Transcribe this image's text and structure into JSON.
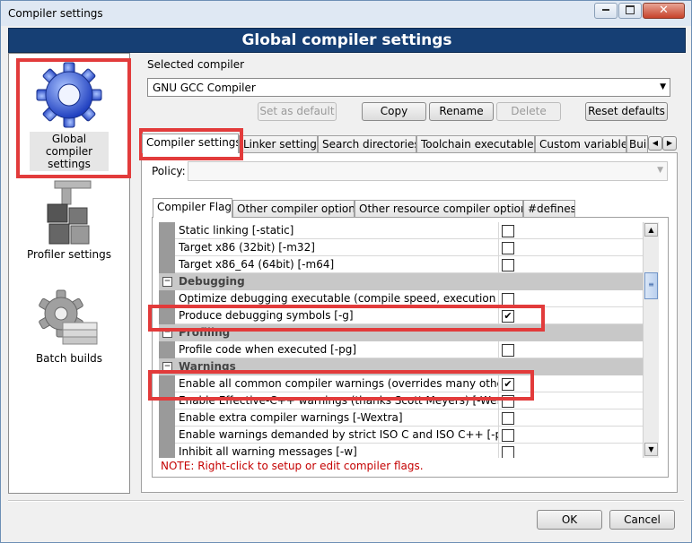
{
  "window": {
    "title": "Compiler settings",
    "minimize": "0",
    "maximize": "1",
    "close": "r"
  },
  "banner": {
    "title": "Global compiler settings"
  },
  "sidebar": {
    "items": [
      {
        "label": "Global compiler settings"
      },
      {
        "label": "Profiler settings"
      },
      {
        "label": "Batch builds"
      }
    ]
  },
  "compiler": {
    "label": "Selected compiler",
    "value": "GNU GCC Compiler",
    "buttons": {
      "set_default": "Set as default",
      "copy": "Copy",
      "rename": "Rename",
      "delete": "Delete",
      "reset": "Reset defaults"
    }
  },
  "main_tabs": [
    "Compiler settings",
    "Linker settings",
    "Search directories",
    "Toolchain executables",
    "Custom variables",
    "Bui"
  ],
  "policy": {
    "label": "Policy:",
    "value": ""
  },
  "sub_tabs": [
    "Compiler Flags",
    "Other compiler options",
    "Other resource compiler options",
    "#defines"
  ],
  "flags": {
    "rows": [
      {
        "type": "flag",
        "name": "Static linking  [-static]",
        "checked": false
      },
      {
        "type": "flag",
        "name": "Target x86 (32bit)  [-m32]",
        "checked": false
      },
      {
        "type": "flag",
        "name": "Target x86_64 (64bit)  [-m64]",
        "checked": false
      },
      {
        "type": "category",
        "name": "Debugging"
      },
      {
        "type": "flag",
        "name": "Optimize debugging executable (compile speed, execution speed",
        "checked": false
      },
      {
        "type": "flag",
        "name": "Produce debugging symbols  [-g]",
        "checked": true
      },
      {
        "type": "category",
        "name": "Profiling"
      },
      {
        "type": "flag",
        "name": "Profile code when executed  [-pg]",
        "checked": false
      },
      {
        "type": "category",
        "name": "Warnings"
      },
      {
        "type": "flag",
        "name": "Enable all common compiler warnings (overrides many other setti",
        "checked": true
      },
      {
        "type": "flag",
        "name": "Enable Effective-C++ warnings (thanks Scott Meyers)  [-Weffc++]",
        "checked": false
      },
      {
        "type": "flag",
        "name": "Enable extra compiler warnings  [-Wextra]",
        "checked": false
      },
      {
        "type": "flag",
        "name": "Enable warnings demanded by strict ISO C and ISO C++  [-pedantic]",
        "checked": false
      },
      {
        "type": "flag",
        "name": "Inhibit all warning messages  [-w]",
        "checked": false
      }
    ]
  },
  "note": "NOTE: Right-click to setup or edit compiler flags.",
  "footer": {
    "ok": "OK",
    "cancel": "Cancel"
  },
  "scroll_arrows": {
    "up": "▲",
    "down": "▼",
    "left": "◀",
    "right": "▶",
    "thumb": "≡"
  },
  "colors": {
    "banner": "#163f74",
    "highlight": "#e23b3b",
    "note": "#c40000"
  },
  "icons": {
    "sidebar": [
      "gear-icon",
      "profiler-icon",
      "batch-builds-icon"
    ],
    "checkmark": "✔",
    "expand": "⊟"
  }
}
